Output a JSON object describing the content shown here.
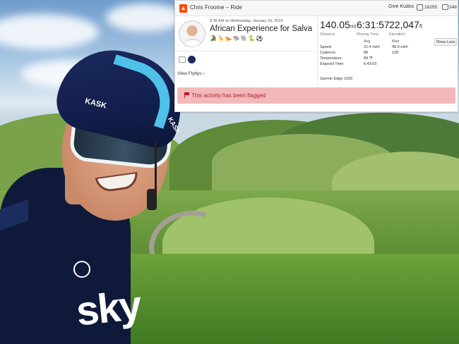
{
  "header": {
    "title": "Chris Froome – Ride",
    "give_kudos": "Give Kudos",
    "kudos_count": "16295",
    "comment_count": "348"
  },
  "activity": {
    "datetime": "8:36 AM on Wednesday, January 16, 2019",
    "name": "African Experience for Salva",
    "emojis": "🐊🦒🐆🐃🐘🐍⚽",
    "view_flybys": "View Flybys ›"
  },
  "stats": [
    {
      "value": "140.05",
      "unit": "mi",
      "label": "Distance"
    },
    {
      "value": "6:31:57",
      "unit": "",
      "label": "Moving Time"
    },
    {
      "value": "22,047",
      "unit": "ft",
      "label": "Elevation"
    }
  ],
  "details": {
    "show_less": "Show Less",
    "col_avg": "Avg",
    "col_max": "Max",
    "rows": [
      {
        "label": "Speed",
        "avg": "21.4 mi/h",
        "max": "48.9 mi/h"
      },
      {
        "label": "Cadence",
        "avg": "88",
        "max": "128"
      },
      {
        "label": "Temperature",
        "avg": "84 ℉",
        "max": ""
      },
      {
        "label": "Elapsed Time",
        "avg": "6:43:03",
        "max": ""
      }
    ],
    "device": "Garmin Edge 1030"
  },
  "flag": {
    "message": "This activity has been flagged",
    "color": "#f3b9b8"
  },
  "photo": {
    "helmet_brand": "KASK",
    "jersey_logo": "sky",
    "team_badge": "TEAM SKY"
  },
  "colors": {
    "strava_orange": "#fc4c02",
    "flag_text": "#b2232a"
  }
}
